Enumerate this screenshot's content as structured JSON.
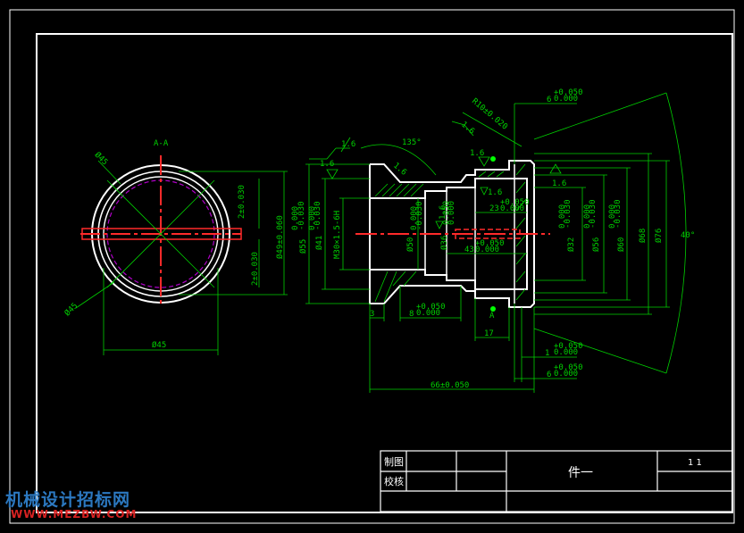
{
  "section_label": "A-A",
  "dims": {
    "chamfer1": "Ø45",
    "chamfer2": "Ø45",
    "front_width": "Ø45",
    "small_tol": "2±0.030",
    "small_tol2": "2±0.030",
    "dia49": "Ø49±0.060",
    "dia55": "Ø55",
    "dia55_tol_u": "0.000",
    "dia55_tol_l": "-0.030",
    "dia41": "Ø41",
    "dia41_tol_u": "0.000",
    "dia41_tol_l": "-0.030",
    "thread": "M30×1.5-6H",
    "dia50": "Ø50",
    "dia50_tol_u": "0.000",
    "dia50_tol_l": "-0.030",
    "dia36": "Ø36",
    "dia36_tol_u": "0.050",
    "dia36_tol_l": "0.000",
    "dia32": "Ø32",
    "dia32_tol_u": "0.000",
    "dia32_tol_l": "-0.030",
    "dia56": "Ø56",
    "dia56_tol_u": "0.000",
    "dia56_tol_l": "-0.030",
    "dia60": "Ø60",
    "dia60_tol_u": "0.000",
    "dia60_tol_l": "-0.030",
    "dia68": "Ø68",
    "dia76": "Ø76",
    "len23": "23",
    "len23_tol_u": "+0.050",
    "len23_tol_l": "0.000",
    "len43": "43",
    "len43_tol_u": "+0.050",
    "len43_tol_l": "0.000",
    "len8": "8",
    "len8_tol_u": "+0.050",
    "len8_tol_l": "0.000",
    "len3": "3",
    "len17": "17",
    "len66": "66±0.050",
    "len1": "1",
    "len1_tol_u": "+0.050",
    "len1_tol_l": "0.000",
    "len6top": "6",
    "len6top_tol_u": "+0.050",
    "len6top_tol_l": "0.000",
    "len6bot": "6",
    "len6bot_tol_u": "+0.050",
    "len6bot_tol_l": "0.000",
    "radius": "R10±0.020",
    "angle135": "135°",
    "angle40": "40°",
    "rough": "1.6",
    "datum": "A"
  },
  "title_block": {
    "drawn_label": "制图",
    "checked_label": "校核",
    "part_name": "件一",
    "sheet": "1  1"
  },
  "watermark": {
    "line1": "机械设计招标网",
    "line2": "WWW.MEZBW.COM"
  }
}
